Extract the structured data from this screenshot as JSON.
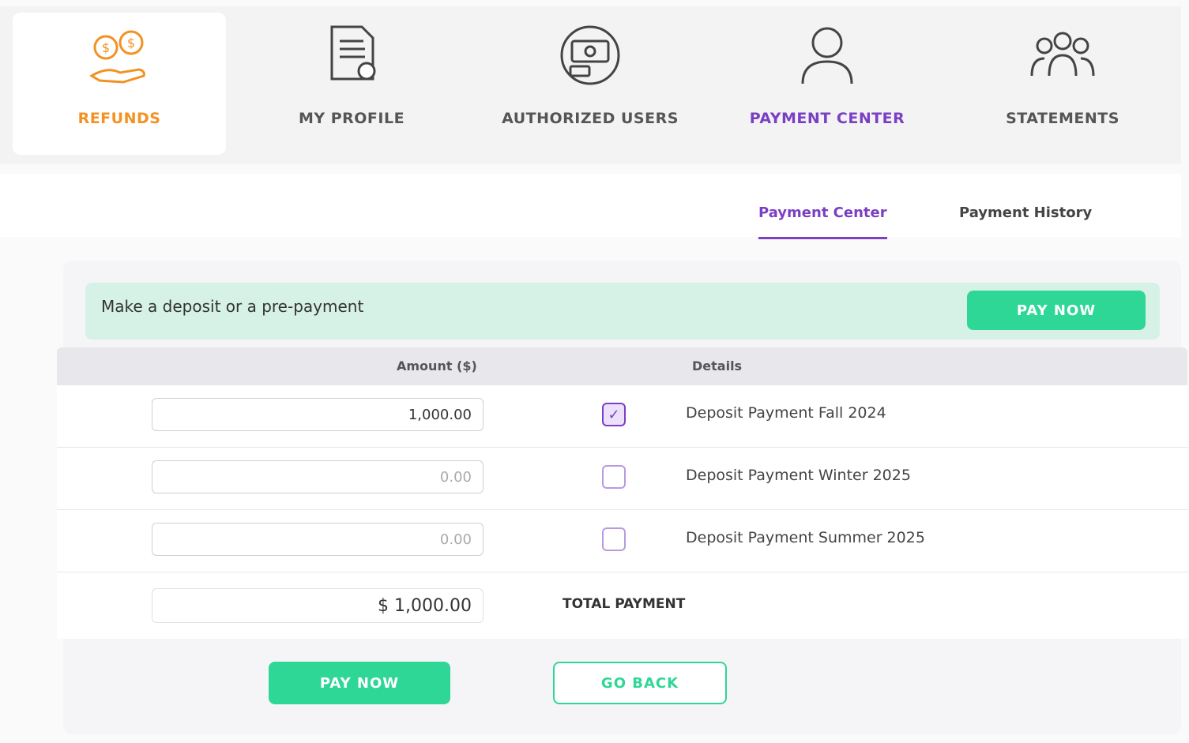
{
  "nav": {
    "items": [
      {
        "label": "REFUNDS",
        "icon": "money-hand-icon",
        "active": true
      },
      {
        "label": "MY PROFILE",
        "icon": "document-user-icon",
        "active": false
      },
      {
        "label": "AUTHORIZED USERS",
        "icon": "payment-cash-icon",
        "active": false
      },
      {
        "label": "PAYMENT CENTER",
        "icon": "person-icon",
        "active": false
      },
      {
        "label": "STATEMENTS",
        "icon": "group-icon",
        "active": false
      }
    ]
  },
  "subtabs": {
    "payment_center": "Payment Center",
    "payment_history": "Payment History"
  },
  "prompt": {
    "text": "Make a deposit or a pre-payment",
    "pay_now_label": "PAY NOW"
  },
  "table": {
    "headers": {
      "amount": "Amount ($)",
      "details": "Details"
    },
    "rows": [
      {
        "amount": "1,000.00",
        "details": "Deposit Payment Fall 2024",
        "checked": true
      },
      {
        "amount": "0.00",
        "details": "Deposit Payment Winter 2025",
        "checked": false
      },
      {
        "amount": "0.00",
        "details": "Deposit Payment Summer 2025",
        "checked": false
      }
    ],
    "total_label": "TOTAL PAYMENT",
    "total_amount": "$ 1,000.00"
  },
  "buttons": {
    "pay_now": "PAY NOW",
    "go_back": "GO BACK"
  },
  "colors": {
    "accent_orange": "#f29223",
    "accent_purple": "#7b3fc4",
    "accent_green": "#2fd796"
  }
}
